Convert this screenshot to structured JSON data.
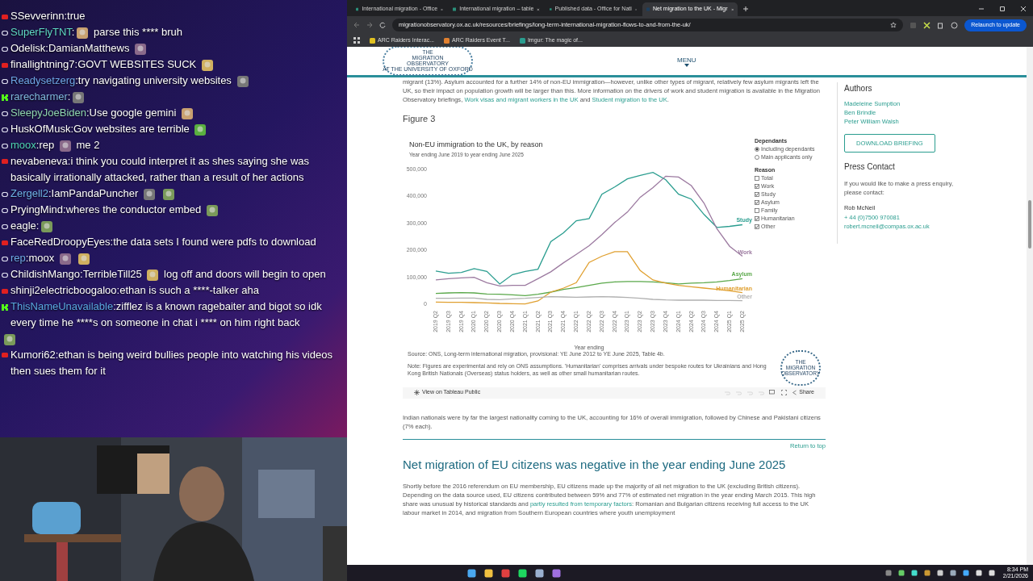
{
  "chat": {
    "separator": ":",
    "messages": [
      {
        "kind": "youtube",
        "user": "SSevverinn",
        "color": "#ffffff",
        "parts": [
          {
            "kind": "text",
            "text": "true"
          }
        ]
      },
      {
        "kind": "twitch",
        "user": "SuperFlyTNT",
        "color": "#5fd8c4",
        "parts": [
          {
            "kind": "emote"
          },
          {
            "kind": "text",
            "text": "parse this **** bruh"
          }
        ]
      },
      {
        "kind": "twitch",
        "user": "Odelisk",
        "color": "#ffffff",
        "parts": [
          {
            "kind": "text",
            "text": "DamianMatthews"
          },
          {
            "kind": "emote"
          }
        ]
      },
      {
        "kind": "youtube",
        "user": "finallightning7",
        "color": "#ffffff",
        "parts": [
          {
            "kind": "text",
            "text": "GOVT WEBSITES SUCK"
          },
          {
            "kind": "emote"
          }
        ]
      },
      {
        "kind": "twitch",
        "user": "Readysetzerg",
        "color": "#6ea6e6",
        "parts": [
          {
            "kind": "text",
            "text": "try navigating university websites"
          },
          {
            "kind": "emote"
          }
        ]
      },
      {
        "kind": "kick",
        "user": "rarecharmer",
        "color": "#7fb6dc",
        "parts": [
          {
            "kind": "emote"
          }
        ]
      },
      {
        "kind": "twitch",
        "user": "SleepyJoeBiden",
        "color": "#8fd6b0",
        "parts": [
          {
            "kind": "text",
            "text": "Use google gemini"
          },
          {
            "kind": "emote"
          }
        ]
      },
      {
        "kind": "twitch",
        "user": "HuskOfMusk",
        "color": "#ffffff",
        "parts": [
          {
            "kind": "text",
            "text": "Gov websites are terrible"
          },
          {
            "kind": "emote"
          }
        ]
      },
      {
        "kind": "twitch",
        "user": "moox",
        "color": "#4fd6b4",
        "parts": [
          {
            "kind": "text",
            "text": "rep"
          },
          {
            "kind": "emote"
          },
          {
            "kind": "text",
            "text": "me 2"
          }
        ]
      },
      {
        "kind": "youtube",
        "user": "nevabeneva",
        "color": "#ffffff",
        "parts": [
          {
            "kind": "text",
            "text": "i think you could interpret it as shes saying she was basically irrationally attacked, rather than a result of her actions"
          }
        ]
      },
      {
        "kind": "twitch",
        "user": "Zergell2",
        "color": "#6eb2e6",
        "parts": [
          {
            "kind": "text",
            "text": "IamPandaPuncher"
          },
          {
            "kind": "emote"
          },
          {
            "kind": "emote"
          }
        ]
      },
      {
        "kind": "twitch",
        "user": "PryingMind",
        "color": "#ffffff",
        "parts": [
          {
            "kind": "text",
            "text": "wheres the conductor embed"
          },
          {
            "kind": "emote"
          }
        ]
      },
      {
        "kind": "twitch",
        "user": "eagle",
        "color": "#ffffff",
        "parts": [
          {
            "kind": "emote"
          }
        ]
      },
      {
        "kind": "youtube",
        "user": "FaceRedDroopyEyes",
        "color": "#ffffff",
        "parts": [
          {
            "kind": "text",
            "text": "the data sets I found were pdfs to download"
          }
        ]
      },
      {
        "kind": "twitch",
        "user": "rep",
        "color": "#6eaae6",
        "parts": [
          {
            "kind": "text",
            "text": "moox"
          },
          {
            "kind": "emote"
          },
          {
            "kind": "emote"
          }
        ]
      },
      {
        "kind": "twitch",
        "user": "ChildishMango",
        "color": "#ffffff",
        "parts": [
          {
            "kind": "text",
            "text": "TerribleTill25"
          },
          {
            "kind": "emote"
          },
          {
            "kind": "text",
            "text": "log off and doors will begin to open"
          }
        ]
      },
      {
        "kind": "youtube",
        "user": "shinji2electricboogaloo",
        "color": "#ffffff",
        "parts": [
          {
            "kind": "text",
            "text": "ethan is such a ****-talker aha"
          }
        ]
      },
      {
        "kind": "kick",
        "user": "ThisNameUnavailable",
        "color": "#5aa8e2",
        "parts": [
          {
            "kind": "text",
            "text": "zifflez is a known ragebaiter and bigot so idk every time he ****s on someone in chat i **** on him right back"
          },
          {
            "kind": "emote"
          }
        ]
      },
      {
        "kind": "youtube",
        "user": "Kumori62",
        "color": "#ffffff",
        "parts": [
          {
            "kind": "text",
            "text": "ethan is being weird bullies people into watching his videos then sues them for it"
          }
        ]
      }
    ]
  },
  "browser": {
    "tabs": [
      {
        "title": "International migration - Office",
        "selected": false
      },
      {
        "title": "International migration – table",
        "selected": false
      },
      {
        "title": "Published data - Office for Nati",
        "selected": false
      },
      {
        "title": "Net migration to the UK - Migr",
        "selected": true
      }
    ],
    "url": "migrationobservatory.ox.ac.uk/resources/briefings/long-term-international-migration-flows-to-and-from-the-uk/",
    "relaunch_button": "Relaunch to update",
    "bookmarks": [
      "ARC Raiders Interac...",
      "ARC Raiders Event T...",
      "Imgur: The magic of..."
    ],
    "page": {
      "logo": {
        "line_1": "THE",
        "line_2": "MIGRATION",
        "line_3": "OBSERVATORY",
        "line_4": "AT THE UNIVERSITY OF OXFORD"
      },
      "menu": "MENU",
      "intro_paragraph": [
        {
          "kind": "text",
          "text": "migrant (13%). Asylum accounted for a further 14% of non-EU immigration—however, unlike other types of migrant, relatively few asylum migrants left the UK, so their impact on population growth will be larger than this. More information on the drivers of work and student migration is available in the Migration Observatory briefings, "
        },
        {
          "kind": "link",
          "text": "Work visas and migrant workers in the UK"
        },
        {
          "kind": "text",
          "text": " and "
        },
        {
          "kind": "link",
          "text": "Student migration to the UK"
        },
        {
          "kind": "text",
          "text": "."
        }
      ],
      "figure": {
        "heading": "Figure 3",
        "subtitle": "Year ending June 2019 to year ending June 2025",
        "dependants": {
          "title": "Dependants",
          "options": [
            {
              "label": "Including dependants",
              "selected": true
            },
            {
              "label": "Main applicants only",
              "selected": false
            }
          ]
        },
        "reason": {
          "title": "Reason",
          "options": [
            {
              "label": "Total",
              "checked": false
            },
            {
              "label": "Work",
              "checked": true
            },
            {
              "label": "Study",
              "checked": true
            },
            {
              "label": "Asylum",
              "checked": true
            },
            {
              "label": "Family",
              "checked": false
            },
            {
              "label": "Humanitarian",
              "checked": true
            },
            {
              "label": "Other",
              "checked": true
            }
          ]
        },
        "chart_data": {
          "type": "line",
          "title": "Non-EU immigration to the UK, by reason",
          "xlabel": "Year ending",
          "categories": [
            "2019 Q2",
            "2019 Q3",
            "2019 Q4",
            "2020 Q1",
            "2020 Q2",
            "2020 Q3",
            "2020 Q4",
            "2021 Q1",
            "2021 Q2",
            "2021 Q3",
            "2021 Q4",
            "2022 Q1",
            "2022 Q2",
            "2022 Q3",
            "2022 Q4",
            "2023 Q1",
            "2023 Q2",
            "2023 Q3",
            "2023 Q4",
            "2024 Q1",
            "2024 Q2",
            "2024 Q3",
            "2024 Q4",
            "2025 Q1",
            "2025 Q2"
          ],
          "ylim": [
            0,
            500000
          ],
          "yticks": [
            {
              "value": 0,
              "label": "0"
            },
            {
              "value": 100000,
              "label": "100,000"
            },
            {
              "value": 200000,
              "label": "200,000"
            },
            {
              "value": 300000,
              "label": "300,000"
            },
            {
              "value": 400000,
              "label": "400,000"
            },
            {
              "value": 500000,
              "label": "500,000"
            }
          ],
          "series": [
            {
              "name": "Study",
              "color": "#2a9d8f",
              "values": [
                123000,
                115000,
                118000,
                132000,
                122000,
                75000,
                110000,
                122000,
                130000,
                232000,
                265000,
                310000,
                318000,
                408000,
                435000,
                465000,
                478000,
                489000,
                462000,
                408000,
                390000,
                333000,
                285000,
                289000,
                295000
              ]
            },
            {
              "name": "Work",
              "color": "#9c7aa0",
              "values": [
                90000,
                95000,
                98000,
                100000,
                80000,
                68000,
                70000,
                70000,
                95000,
                120000,
                154000,
                185000,
                217000,
                258000,
                303000,
                342000,
                397000,
                433000,
                475000,
                472000,
                440000,
                375000,
                280000,
                215000,
                178000
              ]
            },
            {
              "name": "Asylum",
              "color": "#5aa84a",
              "values": [
                40000,
                42000,
                43000,
                42000,
                38000,
                37000,
                35000,
                32000,
                37000,
                45000,
                55000,
                62000,
                70000,
                78000,
                83000,
                84000,
                84000,
                83000,
                80000,
                75000,
                78000,
                80000,
                83000,
                88000,
                95000
              ]
            },
            {
              "name": "Humanitarian",
              "color": "#e0a030",
              "values": [
                8000,
                7000,
                7000,
                6000,
                5000,
                3000,
                2000,
                1000,
                12000,
                45000,
                60000,
                80000,
                155000,
                178000,
                195000,
                195000,
                125000,
                90000,
                78000,
                70000,
                65000,
                60000,
                55000,
                50000,
                43000
              ]
            },
            {
              "name": "Other",
              "color": "#b0b0b0",
              "values": [
                22000,
                22000,
                23000,
                23000,
                18000,
                17000,
                20000,
                22000,
                25000,
                28000,
                27000,
                26000,
                27000,
                28000,
                27000,
                25000,
                22000,
                18000,
                16000,
                15000,
                15000,
                15000,
                14000,
                14000,
                13000
              ]
            }
          ]
        },
        "source": "Source: ONS, Long-term international migration, provisional: YE June 2012 to YE June 2025, Table 4b.",
        "note": "Note: Figures are experimental and rely on ONS assumptions. 'Humanitarian' comprises arrivals under bespoke routes for Ukrainians and Hong Kong British Nationals (Overseas) status holders, as well as other small humanitarian routes.",
        "badge": {
          "line_1": "THE",
          "line_2": "MIGRATION",
          "line_3": "OBSERVATORY"
        },
        "tableau_link": "View on Tableau Public",
        "share": "Share"
      },
      "nationality_paragraph": "Indian nationals were by far the largest nationality coming to the UK, accounting for 16% of overall immigration, followed by Chinese and Pakistani citizens (7% each).",
      "return_to_top": "Return to top",
      "section_heading": "Net migration of EU citizens was negative in the year ending June 2025",
      "section_paragraph": [
        {
          "kind": "text",
          "text": "Shortly before the 2016 referendum on EU membership, EU citizens made up the majority of all net migration to the UK (excluding British citizens). Depending on the data source used, EU citizens contributed between 59% and 77% of estimated net migration in the year ending March 2015. This high share was unusual by historical standards and "
        },
        {
          "kind": "link",
          "text": "partly resulted from temporary factors"
        },
        {
          "kind": "text",
          "text": ": Romanian and Bulgarian citizens receiving full access to the UK labour market in 2014, and migration from Southern European countries where youth unemployment"
        }
      ],
      "sidebar": {
        "authors_title": "Authors",
        "authors": [
          "Madeleine Sumption",
          "Ben Brindle",
          "Peter William Walsh"
        ],
        "download_button": "DOWNLOAD BRIEFING",
        "press_title": "Press Contact",
        "press_text": "If you would like to make a press enquiry, please contact:",
        "contact_name": "Rob McNeil",
        "phone": "+ 44 (0)7500 970081",
        "email": "robert.mcneil@compas.ox.ac.uk"
      }
    }
  },
  "taskbar": {
    "time": "8:34 PM",
    "date": "2/21/2026"
  }
}
